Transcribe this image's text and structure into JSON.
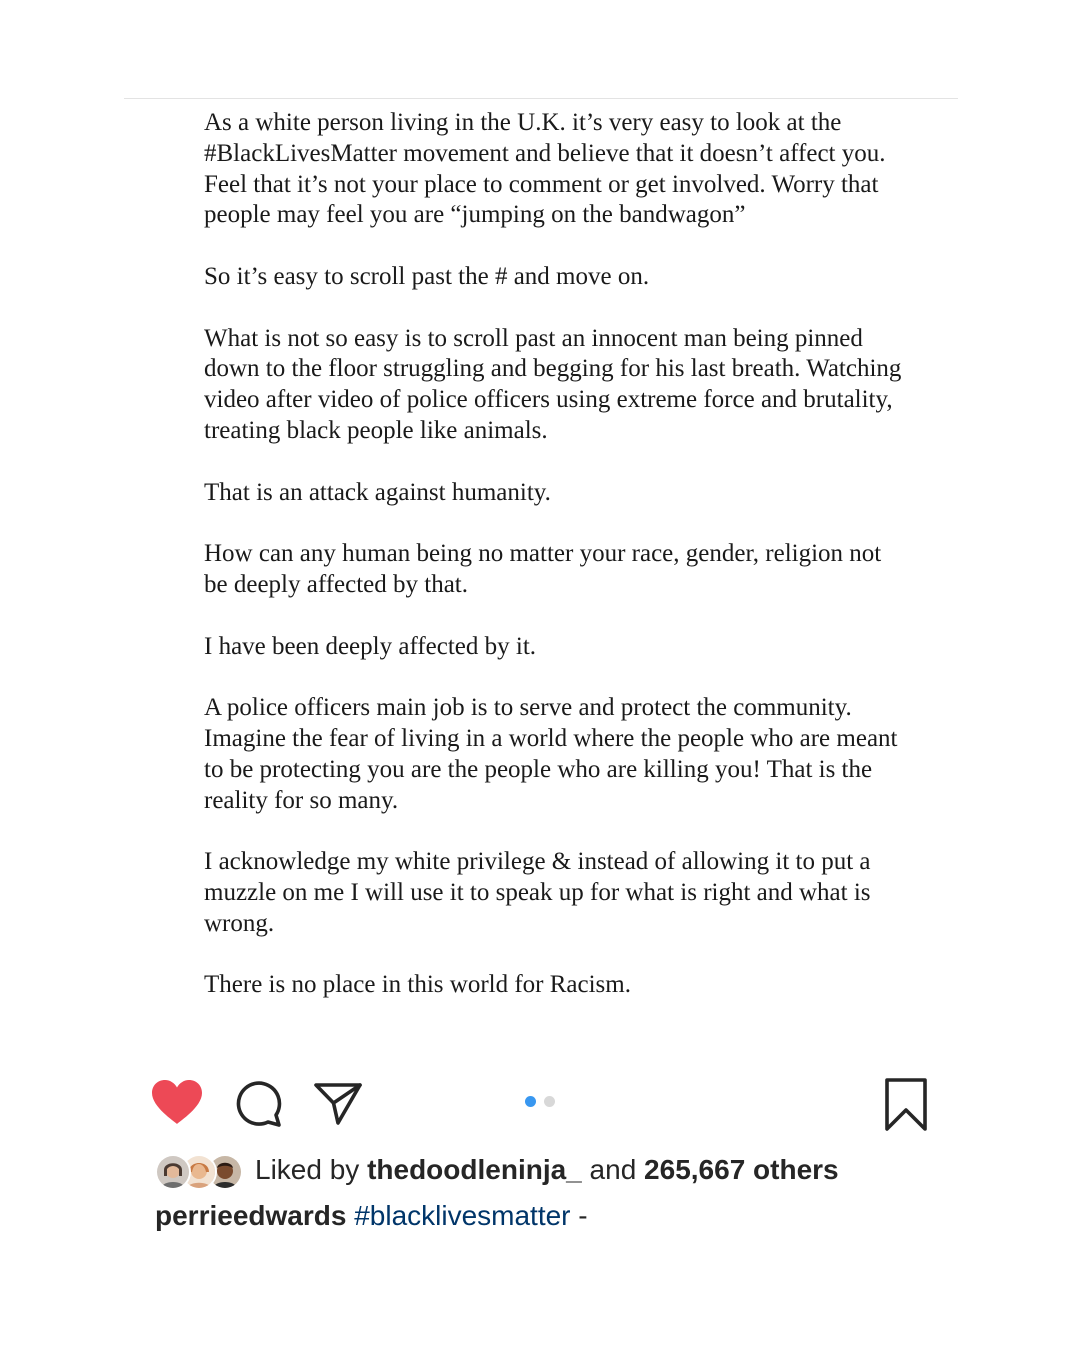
{
  "post": {
    "paragraphs": [
      "As a white person living in the U.K. it’s very easy to look at the #BlackLivesMatter movement and believe that it doesn’t affect you. Feel that it’s not your place to comment or get involved. Worry that people may feel you are “jumping on the bandwagon”",
      "So it’s easy to scroll past the # and move on.",
      "What is not so easy is to scroll past an innocent man being pinned down to the floor struggling and begging for his last breath. Watching video after video of police officers using extreme force and brutality, treating black people like animals.",
      "That is an attack against humanity.",
      "How can any human being no matter your race, gender, religion not be deeply affected by that.",
      "I have been deeply affected by it.",
      "A police officers main job is to serve and protect the community. Imagine the fear of living in a world where the people who are meant to be protecting you are the people who are killing you! That is the reality for so many.",
      "I acknowledge my white privilege & instead of allowing it to put a muzzle on me I will use it to speak up for what is right and what is wrong.",
      "There is no place in this world for Racism."
    ]
  },
  "actions": {
    "like_icon": "heart-icon",
    "comment_icon": "speech-bubble-icon",
    "share_icon": "paper-plane-icon",
    "save_icon": "bookmark-icon",
    "liked": true,
    "like_color": "#ed4956",
    "carousel": {
      "total": 2,
      "current": 1,
      "active_color": "#3897f0"
    }
  },
  "likes": {
    "prefix": "Liked by",
    "user": "thedoodleninja_",
    "connector": "and",
    "count": "265,667 others"
  },
  "caption": {
    "username": "perrieedwards",
    "hashtag": "#blacklivesmatter",
    "text": "-"
  }
}
